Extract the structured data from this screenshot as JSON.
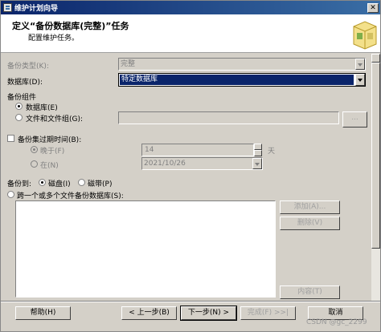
{
  "window": {
    "title": "维护计划向导"
  },
  "header": {
    "title": "定义“备份数据库(完整)”任务",
    "subtitle": "配置维护任务。"
  },
  "form": {
    "backup_type_label": "备份类型(K):",
    "backup_type_value": "完整",
    "database_label": "数据库(D):",
    "database_value": "特定数据库",
    "backup_component_label": "备份组件",
    "radio_database_label": "数据库(E)",
    "radio_files_label": "文件和文件组(G):",
    "browse_label": "...",
    "expire_checkbox_label": "备份集过期时间(B):",
    "after_label": "晚于(F)",
    "after_value": "14",
    "days_label": "天",
    "on_label": "在(N)",
    "on_value": "2021/10/26",
    "backup_to_label": "备份到:",
    "disk_label": "磁盘(I)",
    "tape_label": "磁带(P)",
    "span_files_label": "跨一个或多个文件备份数据库(S):",
    "add_button": "添加(A)...",
    "remove_button": "删除(V)",
    "content_button": "内容(T)"
  },
  "footer": {
    "help": "帮助(H)",
    "back": "< 上一步(B)",
    "next": "下一步(N) >",
    "finish": "完成(F) >>|",
    "cancel": "取消"
  },
  "watermark": "CSDN @gc_2299"
}
